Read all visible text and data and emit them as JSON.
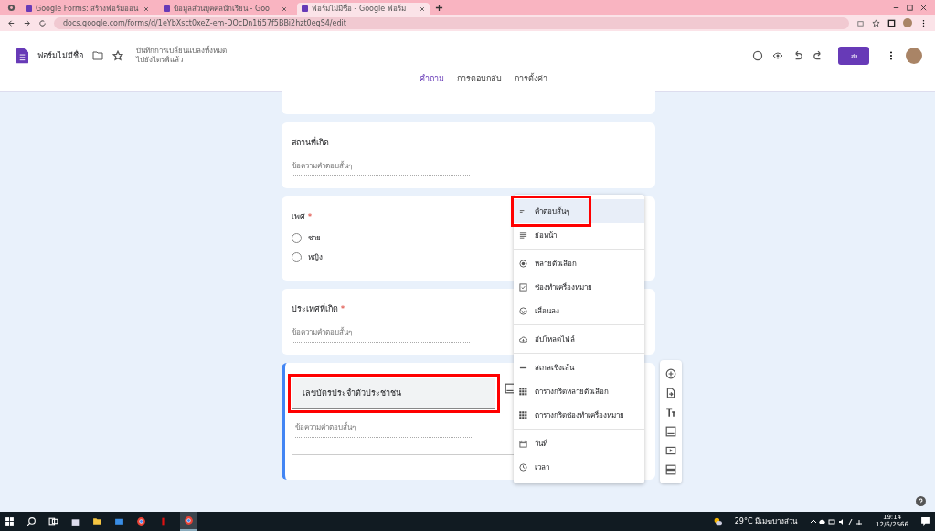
{
  "browser": {
    "tabs": [
      {
        "title": "Google Forms: สร้างฟอร์มออน",
        "selected": false
      },
      {
        "title": "ข้อมูลส่วนบุคคลนักเรียน - Goo",
        "selected": false
      },
      {
        "title": "ฟอร์มไม่มีชื่อ - Google ฟอร์ม",
        "selected": true
      }
    ],
    "url": "docs.google.com/forms/d/1eYbXsct0xeZ-em-DOcDn1ti57f5BBi2hzt0egS4/edit"
  },
  "header": {
    "title": "ฟอร์มไม่มีชื่อ",
    "save_status": "บันทึกการเปลี่ยนแปลงทั้งหมด\nไปยังไดรฟ์แล้ว",
    "send_button": "ส่ง",
    "nav_tabs": [
      {
        "label": "คำถาม",
        "selected": true
      },
      {
        "label": "การตอบกลับ",
        "selected": false
      },
      {
        "label": "การตั้งค่า",
        "selected": false
      }
    ]
  },
  "questions": [
    {
      "kind": "short",
      "title": "สถานที่เกิด",
      "placeholder": "ข้อความคำตอบสั้นๆ",
      "active": false,
      "highlighted": false
    },
    {
      "kind": "choice",
      "title": "เพศ",
      "required_mark": "*",
      "options": [
        "ชาย",
        "หญิง"
      ],
      "active": false,
      "highlighted": false
    },
    {
      "kind": "short",
      "title": "ประเทศที่เกิด",
      "required_mark": "*",
      "placeholder": "ข้อความคำตอบสั้นๆ",
      "active": false,
      "highlighted": false
    },
    {
      "kind": "short",
      "title": "เลขบัตรประจำตัวประชาชน",
      "placeholder": "ข้อความคำตอบสั้นๆ",
      "active": true,
      "highlighted": true
    }
  ],
  "type_menu": {
    "groups": [
      [
        {
          "kind": "short",
          "label": "คำตอบสั้นๆ",
          "selected": true,
          "highlighted": true
        },
        {
          "kind": "paragraph",
          "label": "ย่อหน้า",
          "selected": false,
          "highlighted": false
        }
      ],
      [
        {
          "kind": "radio",
          "label": "หลายตัวเลือก",
          "selected": false,
          "highlighted": false
        },
        {
          "kind": "checkbox",
          "label": "ช่องทำเครื่องหมาย",
          "selected": false,
          "highlighted": false
        },
        {
          "kind": "dropdown",
          "label": "เลื่อนลง",
          "selected": false,
          "highlighted": false
        }
      ],
      [
        {
          "kind": "upload",
          "label": "อัปโหลดไฟล์",
          "selected": false,
          "highlighted": false
        }
      ],
      [
        {
          "kind": "scale",
          "label": "สเกลเชิงเส้น",
          "selected": false,
          "highlighted": false
        },
        {
          "kind": "grid",
          "label": "ตารางกริดหลายตัวเลือก",
          "selected": false,
          "highlighted": false
        },
        {
          "kind": "grid",
          "label": "ตารางกริดช่องทำเครื่องหมาย",
          "selected": false,
          "highlighted": false
        }
      ],
      [
        {
          "kind": "date",
          "label": "วันที่",
          "selected": false,
          "highlighted": false
        },
        {
          "kind": "time",
          "label": "เวลา",
          "selected": false,
          "highlighted": false
        }
      ]
    ]
  },
  "taskbar": {
    "weather": "29°C มีเมฆบางส่วน",
    "time": "19:14",
    "date": "12/6/2566"
  }
}
